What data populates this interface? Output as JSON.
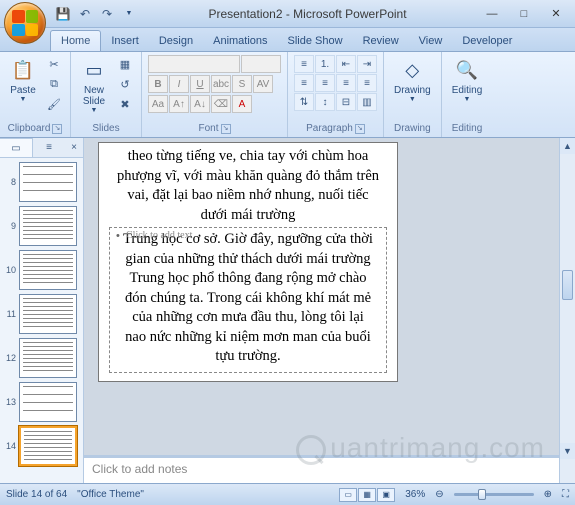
{
  "title": "Presentation2 - Microsoft PowerPoint",
  "qat": {
    "save": "save-icon",
    "undo": "undo-icon",
    "redo": "redo-icon"
  },
  "tabs": [
    "Home",
    "Insert",
    "Design",
    "Animations",
    "Slide Show",
    "Review",
    "View",
    "Developer"
  ],
  "active_tab": 0,
  "ribbon": {
    "clipboard": {
      "label": "Clipboard",
      "paste": "Paste"
    },
    "slides": {
      "label": "Slides",
      "new_slide": "New\nSlide"
    },
    "font": {
      "label": "Font"
    },
    "paragraph": {
      "label": "Paragraph"
    },
    "drawing": {
      "label": "Drawing",
      "btn": "Drawing"
    },
    "editing": {
      "label": "Editing",
      "btn": "Editing"
    }
  },
  "slidepanel": {
    "tabs": [
      "Slides",
      "Outline"
    ],
    "close": "×",
    "thumbs": [
      {
        "num": 8
      },
      {
        "num": 9
      },
      {
        "num": 10
      },
      {
        "num": 11
      },
      {
        "num": 12
      },
      {
        "num": 13
      },
      {
        "num": 14,
        "active": true
      }
    ]
  },
  "slide": {
    "top_text": "theo từng tiếng ve, chia tay với chùm hoa phượng vĩ, với màu khăn quàng đỏ thắm trên vai, đặt lại bao niềm nhớ nhung, nuối tiếc dưới mái trường",
    "click_text": "Click to add text",
    "body_text": "Trung học cơ sở. Giờ đây, ngưỡng cửa thời gian của những thử thách dưới mái trường Trung học phổ thông đang rộng mở chào đón chúng ta. Trong cái không khí mát mẻ của những cơn mưa đầu thu, lòng tôi lại nao nức những kỉ niệm mơn man của buổi tựu trường."
  },
  "notes_placeholder": "Click to add notes",
  "status": {
    "slide": "Slide 14 of 64",
    "theme": "\"Office Theme\"",
    "zoom": "36%"
  },
  "watermark": "uantrimang.com"
}
